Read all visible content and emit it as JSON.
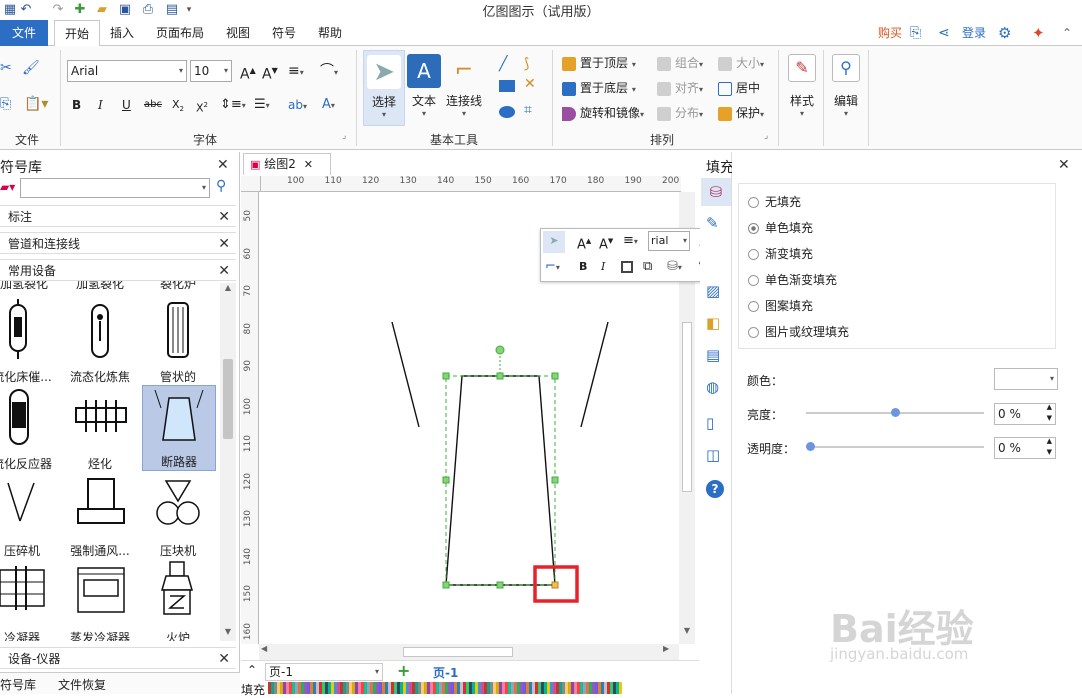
{
  "window": {
    "title": "亿图图示（试用版）"
  },
  "tabs": {
    "file": "文件",
    "items": [
      "开始",
      "插入",
      "页面布局",
      "视图",
      "符号",
      "帮助"
    ]
  },
  "account": {
    "buy": "购买",
    "login": "登录"
  },
  "ribbon": {
    "font_name": "Arial",
    "font_size": "10",
    "groups": {
      "file": "文件",
      "font": "字体",
      "basic_tools": "基本工具",
      "arrange": "排列"
    },
    "select": "选择",
    "text": "文本",
    "connector": "连接线",
    "arrange": {
      "bring_front": "置于顶层",
      "send_back": "置于底层",
      "rotate": "旋转和镜像",
      "group": "组合",
      "align": "对齐",
      "distribute": "分布",
      "size": "大小",
      "center": "居中",
      "protect": "保护"
    },
    "style": "样式",
    "edit": "编辑"
  },
  "library": {
    "title": "符号库",
    "search_placeholder": "",
    "sections": [
      "标注",
      "管道和连接线",
      "常用设备"
    ],
    "top_cut_labels": [
      "加氢裂化",
      "加氢裂化",
      "裂化炉"
    ],
    "shapes": [
      "流化床催...",
      "流态化炼焦",
      "管状的",
      "流化反应器",
      "烃化",
      "断路器",
      "压碎机",
      "强制通风...",
      "压块机",
      "冷凝器",
      "蒸发冷凝器",
      "火炉"
    ],
    "bottom_section": "设备-仪器",
    "bottom_tabs": [
      "符号库",
      "文件恢复"
    ]
  },
  "document": {
    "tab_name": "绘图2",
    "page_name": "页-1",
    "page_tab": "页-1"
  },
  "ruler": {
    "h": [
      "100",
      "110",
      "120",
      "130",
      "140",
      "150",
      "160",
      "170",
      "180",
      "190",
      "200"
    ],
    "v": [
      "50",
      "60",
      "70",
      "80",
      "90",
      "100",
      "110",
      "120",
      "130",
      "140",
      "150",
      "160"
    ]
  },
  "float_toolbar": {
    "font": "rial"
  },
  "fill_panel": {
    "title": "填充",
    "options": [
      "无填充",
      "单色填充",
      "渐变填充",
      "单色渐变填充",
      "图案填充",
      "图片或纹理填充"
    ],
    "selected_index": 1,
    "color_label": "颜色：",
    "brightness_label": "亮度：",
    "brightness_value": "0 %",
    "transparency_label": "透明度：",
    "transparency_value": "0 %"
  },
  "status": {
    "fill_label": "填充"
  },
  "watermark": {
    "brand": "Bai经验",
    "url": "jingyan.baidu.com"
  },
  "colors": {
    "accent": "#2b6ec4",
    "selected_handle": "#e8222a",
    "selection": "#3bb03b"
  }
}
